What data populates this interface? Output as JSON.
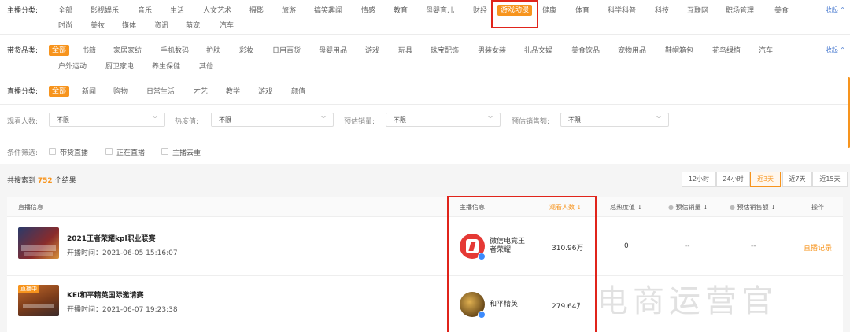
{
  "topic": {
    "label": "主播分类:",
    "items": [
      "全部",
      "影视娱乐",
      "音乐",
      "生活",
      "人文艺术",
      "摄影",
      "旅游",
      "搞笑趣闻",
      "情感",
      "教育",
      "母婴育儿",
      "财经",
      "游戏动漫",
      "健康",
      "体育",
      "科学科普",
      "科技",
      "互联网",
      "职场管理",
      "美食",
      "时尚",
      "美妆",
      "媒体",
      "资讯",
      "萌宠",
      "汽车"
    ],
    "highlight": "游戏动漫",
    "collapse": "收起 ^"
  },
  "goods": {
    "label": "带货品类:",
    "items": [
      "全部",
      "书籍",
      "家居家纺",
      "手机数码",
      "护肤",
      "彩妆",
      "日用百货",
      "母婴用品",
      "游戏",
      "玩具",
      "珠宝配饰",
      "男装女装",
      "礼品文娱",
      "美食饮品",
      "宠物用品",
      "鞋帽箱包",
      "花鸟绿植",
      "汽车",
      "户外运动",
      "厨卫家电",
      "养生保健",
      "其他"
    ],
    "active": "全部",
    "collapse": "收起 ^"
  },
  "live": {
    "label": "直播分类:",
    "items": [
      "全部",
      "新闻",
      "购物",
      "日常生活",
      "才艺",
      "教学",
      "游戏",
      "颜值"
    ],
    "active": "全部"
  },
  "filters": [
    {
      "label": "观看人数:",
      "value": "不限"
    },
    {
      "label": "热度值:",
      "value": "不限"
    },
    {
      "label": "预估销量:",
      "value": "不限"
    },
    {
      "label": "预估销售额:",
      "value": "不限"
    }
  ],
  "conditions": {
    "label": "条件筛选:",
    "options": [
      "带货直播",
      "正在直播",
      "主播去重"
    ]
  },
  "results": {
    "prefix": "共搜索到",
    "count": "752",
    "suffix": "个结果"
  },
  "time_tabs": [
    "12小时",
    "24小时",
    "近3天",
    "近7天",
    "近15天"
  ],
  "time_active": "近3天",
  "table": {
    "headers": {
      "live_info": "直播信息",
      "anchor_info": "主播信息",
      "viewers": "观看人数 ↓",
      "heat": "总热度值 ↓",
      "sales": "预估销量 ↓",
      "revenue": "预估销售额 ↓",
      "action": "操作"
    },
    "rows": [
      {
        "title": "2021王者荣耀kpl职业联赛",
        "time": "开播时间：2021-06-05 15:16:07",
        "anchor": "微信电竞王者荣耀",
        "anchor_l1": "微信电竞王",
        "anchor_l2": "者荣耀",
        "viewers": "310.96万",
        "heat": "0",
        "sales": "--",
        "revenue": "--",
        "action": "直播记录",
        "live": false
      },
      {
        "title": "KEI和平精英国际邀请赛",
        "time": "开播时间：2021-06-07 19:23:38",
        "anchor": "和平精英",
        "viewers": "279.64万",
        "badge": "直播中",
        "live": true
      }
    ]
  },
  "watermark": "电商运营官",
  "colors": {
    "accent": "#f7941d",
    "annotation": "#e0241b",
    "link": "#4a7bd0"
  }
}
